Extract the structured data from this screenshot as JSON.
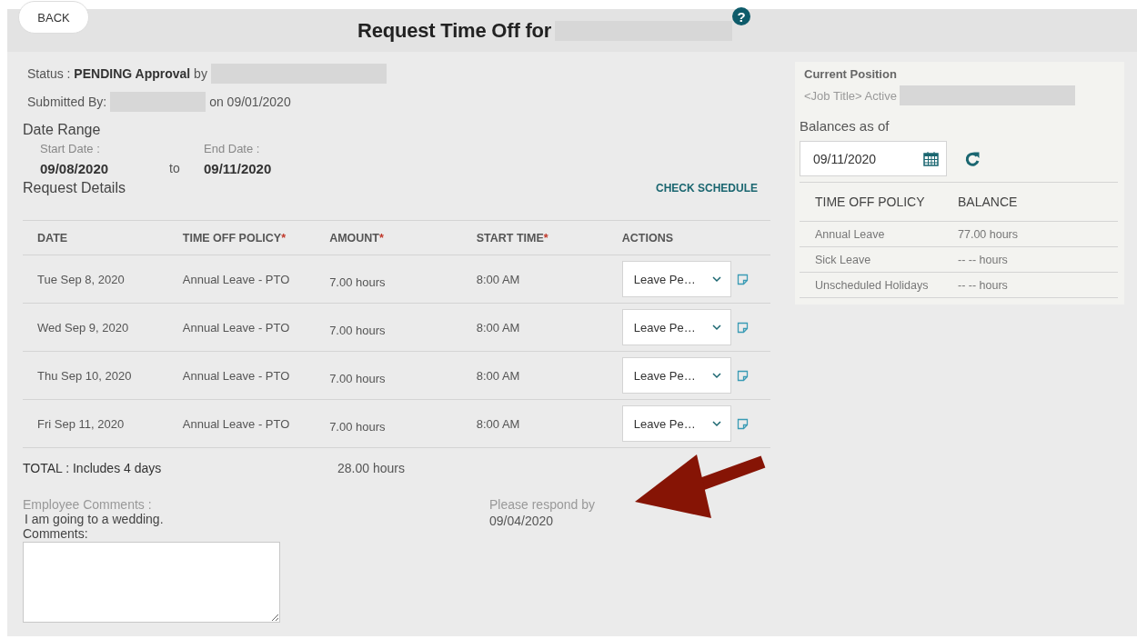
{
  "header": {
    "back": "BACK",
    "title": "Request Time Off for",
    "help": "?"
  },
  "status": {
    "label": "Status :",
    "value": "PENDING Approval",
    "by": "by"
  },
  "submitted": {
    "label": "Submitted By:",
    "on": "on 09/01/2020"
  },
  "date_range": {
    "heading": "Date Range",
    "start_label": "Start Date :",
    "start": "09/08/2020",
    "to": "to",
    "end_label": "End Date :",
    "end": "09/11/2020"
  },
  "request_details": {
    "heading": "Request Details",
    "check_schedule": "CHECK SCHEDULE"
  },
  "table": {
    "columns": [
      {
        "label": "DATE"
      },
      {
        "label": "TIME OFF POLICY",
        "required_mark": "*"
      },
      {
        "label": "AMOUNT",
        "required_mark": "*"
      },
      {
        "label": "START TIME",
        "required_mark": "*"
      },
      {
        "label": "ACTIONS"
      }
    ],
    "rows": [
      {
        "date": "Tue Sep 8, 2020",
        "policy": "Annual Leave - PTO",
        "amount": "7.00 hours",
        "start": "8:00 AM",
        "action": "Leave Pe…"
      },
      {
        "date": "Wed Sep 9, 2020",
        "policy": "Annual Leave - PTO",
        "amount": "7.00 hours",
        "start": "8:00 AM",
        "action": "Leave Pe…"
      },
      {
        "date": "Thu Sep 10, 2020",
        "policy": "Annual Leave - PTO",
        "amount": "7.00 hours",
        "start": "8:00 AM",
        "action": "Leave Pe…"
      },
      {
        "date": "Fri Sep 11, 2020",
        "policy": "Annual Leave - PTO",
        "amount": "7.00 hours",
        "start": "8:00 AM",
        "action": "Leave Pe…"
      }
    ]
  },
  "total": {
    "label": "TOTAL :",
    "value": "Includes 4 days",
    "amount": "28.00 hours"
  },
  "comments": {
    "employee_label": "Employee Comments :",
    "employee_text": "I am going to a wedding.",
    "label": "Comments:"
  },
  "respond": {
    "label": "Please respond by",
    "date": "09/04/2020"
  },
  "sidebar": {
    "position_heading": "Current Position",
    "position_text": "<Job Title> Active",
    "balances_label": "Balances as of",
    "date": "09/11/2020",
    "columns": [
      "TIME OFF POLICY",
      "BALANCE"
    ],
    "rows": [
      {
        "policy": "Annual Leave",
        "balance": "77.00 hours"
      },
      {
        "policy": "Sick Leave",
        "balance": "-- -- hours"
      },
      {
        "policy": "Unscheduled Holidays",
        "balance": "-- -- hours"
      }
    ]
  }
}
